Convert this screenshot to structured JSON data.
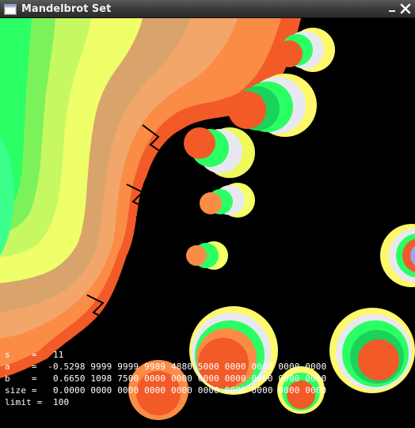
{
  "window": {
    "title": "Mandelbrot Set"
  },
  "icons": {
    "app": "window-app-icon",
    "minimize": "minimize-icon",
    "close": "close-icon"
  },
  "info": {
    "s_line": "s    =   11",
    "a_line": "a    =  -0.5298 9999 9999 9989 4880 5000 0000 0000 0000 0000",
    "b_line": "b    =   0.6650 1098 7500 0000 0000 0000 0000 0000 0000 0000",
    "size_line": "size =   0.0000 0000 0000 0000 0000 0000 0000 0000 0000 0000",
    "limit_line": "limit =  100"
  },
  "colors": {
    "black": "#000000",
    "green_bright": "#32ff7a",
    "green_mid": "#2aff64",
    "lime": "#baf65c",
    "yellow": "#f0ff6a",
    "tan": "#d8a46c",
    "orange": "#fa8c46",
    "red_orange": "#f25a28",
    "palette_blue": "#3a3aff"
  }
}
